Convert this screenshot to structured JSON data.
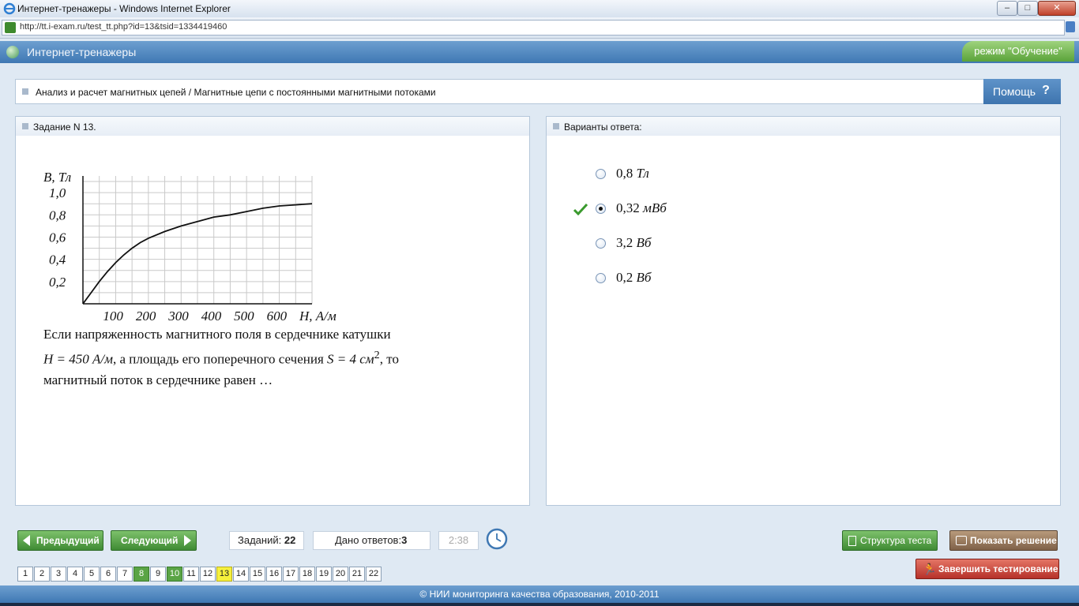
{
  "browser": {
    "title": "Интернет-тренажеры - Windows Internet Explorer",
    "url": "http://tt.i-exam.ru/test_tt.php?id=13&tsid=1334419460"
  },
  "header": {
    "app_title": "Интернет-тренажеры",
    "mode": "режим \"Обучение\"",
    "accent_color": "#3f78b3"
  },
  "breadcrumb": {
    "text": "Анализ и расчет магнитных цепей / Магнитные цепи с постоянными магнитными потоками",
    "help_label": "Помощь",
    "help_icon": "?"
  },
  "task": {
    "title": "Задание N 13.",
    "question_line1": "Если напряженность магнитного поля в сердечнике катушки",
    "question_H": "H = 450 А/м",
    "question_mid": ",  а площадь его поперечного сечения",
    "question_S": "S = 4 см",
    "question_S_exp": "2",
    "question_end": ",  то",
    "question_line3": "магнитный поток в сердечнике равен …"
  },
  "chart_data": {
    "type": "line",
    "ylabel": "B, Тл",
    "xlabel": "H, А/м",
    "y_ticks": [
      "1,0",
      "0,8",
      "0,6",
      "0,4",
      "0,2"
    ],
    "x_ticks": [
      "100",
      "200",
      "300",
      "400",
      "500",
      "600"
    ],
    "xlim": [
      0,
      700
    ],
    "ylim": [
      0,
      1.15
    ],
    "grid": true,
    "series": [
      {
        "x": [
          0,
          25,
          50,
          75,
          100,
          125,
          150,
          175,
          200,
          250,
          300,
          350,
          400,
          450,
          500,
          550,
          600,
          650,
          700
        ],
        "y": [
          0,
          0.1,
          0.2,
          0.29,
          0.37,
          0.44,
          0.5,
          0.55,
          0.59,
          0.65,
          0.7,
          0.74,
          0.78,
          0.8,
          0.83,
          0.86,
          0.88,
          0.89,
          0.9
        ]
      }
    ]
  },
  "answers": {
    "title": "Варианты ответа:",
    "options": [
      {
        "num": "0,8",
        "unit": "Тл",
        "selected": false
      },
      {
        "num": "0,32",
        "unit": "мВб",
        "selected": true
      },
      {
        "num": "3,2",
        "unit": "Вб",
        "selected": false
      },
      {
        "num": "0,2",
        "unit": "Вб",
        "selected": false
      }
    ],
    "correct_color": "#3a9a2e"
  },
  "nav": {
    "prev_label": "Предыдущий",
    "next_label": "Следующий",
    "tasks_label": "Заданий:",
    "tasks_value": "22",
    "answered_label": "Дано ответов:",
    "answered_value": "3",
    "timer": "2:38",
    "structure_label": "Структура теста",
    "solution_label": "Показать решение",
    "finish_label": "Завершить тестирование"
  },
  "pager": {
    "pages": [
      "1",
      "2",
      "3",
      "4",
      "5",
      "6",
      "7",
      "8",
      "9",
      "10",
      "11",
      "12",
      "13",
      "14",
      "15",
      "16",
      "17",
      "18",
      "19",
      "20",
      "21",
      "22"
    ],
    "answered": [
      "8",
      "10"
    ],
    "current": "13"
  },
  "footer": {
    "text": "© НИИ мониторинга качества образования, 2010-2011"
  }
}
